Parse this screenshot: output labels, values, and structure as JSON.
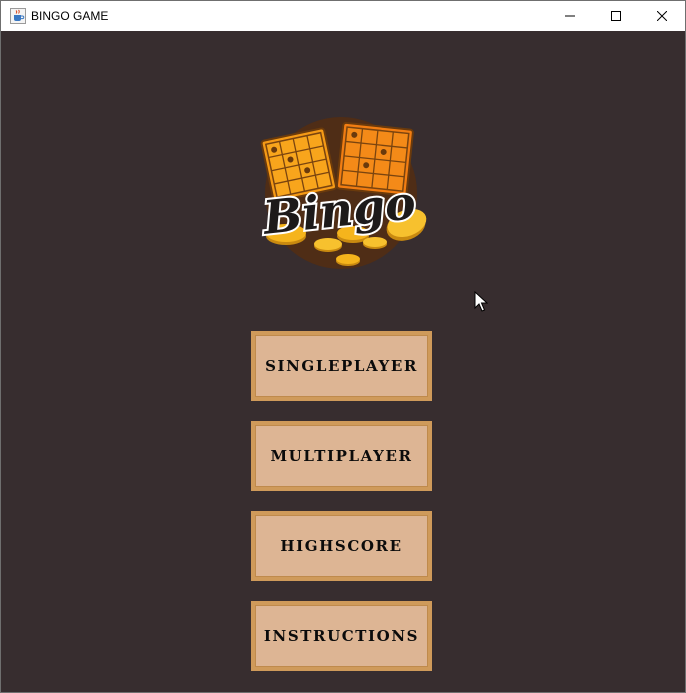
{
  "window": {
    "title": "BINGO GAME"
  },
  "logo": {
    "text": "Bingo"
  },
  "menu": {
    "singleplayer_label": "SINGLEPLAYER",
    "multiplayer_label": "MULTIPLAYER",
    "highscore_label": "HIGHSCORE",
    "instructions_label": "INSTRUCTIONS"
  },
  "colors": {
    "background": "#372d2f",
    "button_fill": "#ddb594",
    "button_border": "#cf9a5a",
    "logo_orange": "#f28a12",
    "coin_gold": "#f5b41c"
  },
  "icons": {
    "app": "java-cup-icon",
    "minimize": "minimize-icon",
    "maximize": "maximize-icon",
    "close": "close-icon",
    "cursor": "mouse-pointer-icon"
  }
}
